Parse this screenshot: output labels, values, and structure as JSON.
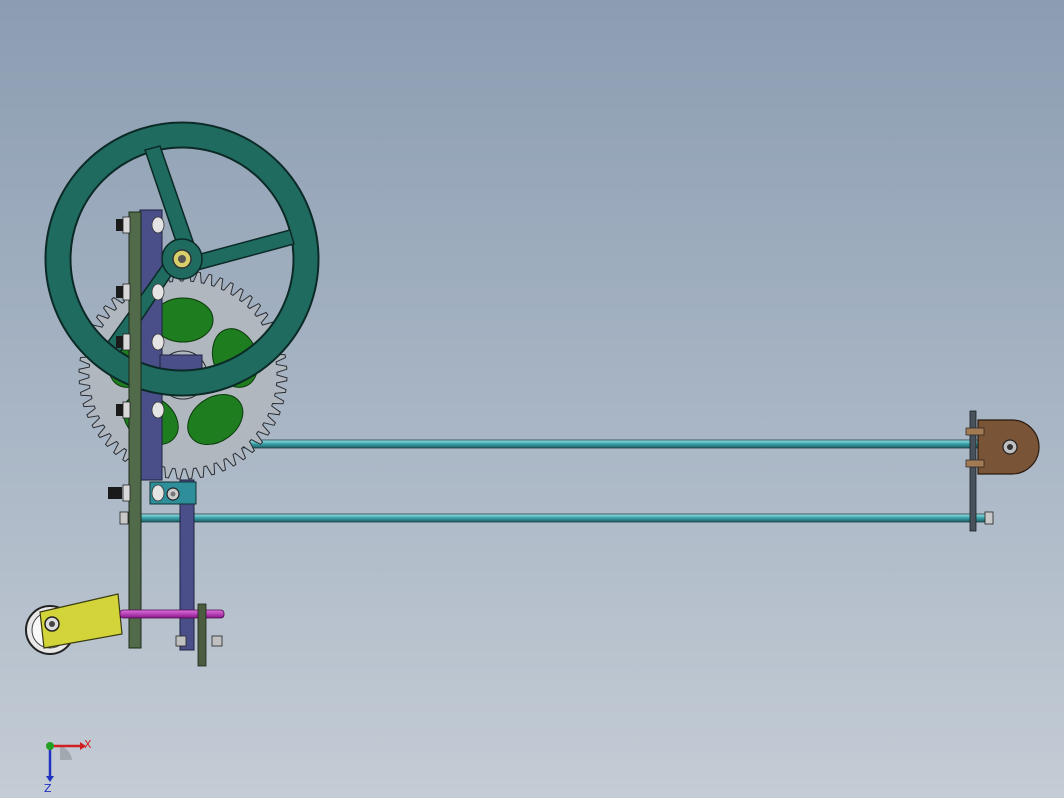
{
  "view": {
    "background_top": "#8c9db2",
    "background_bottom": "#c4ccd5"
  },
  "model": {
    "parts": [
      "handwheel",
      "spur-gear",
      "vertical-frame-plate",
      "bracket",
      "upper-rod",
      "lower-rod",
      "end-plate",
      "pulley-clamp",
      "pulley",
      "axle",
      "nut"
    ],
    "colors": {
      "handwheel": "#1f6b60",
      "gear": "#b0b7bf",
      "gear_web": "#1e7d1e",
      "frame_plate": "#506a4a",
      "bracket": "#4a4f8a",
      "rod": "#39a0a8",
      "end_plate": "#7a5437",
      "clamp": "#d2d43a",
      "axle": "#b020b0",
      "bolt": "#222222"
    }
  },
  "triad": {
    "x_label": "X",
    "z_label": "Z",
    "x_color": "#d02020",
    "y_color": "#20a020",
    "z_color": "#2030c0"
  }
}
